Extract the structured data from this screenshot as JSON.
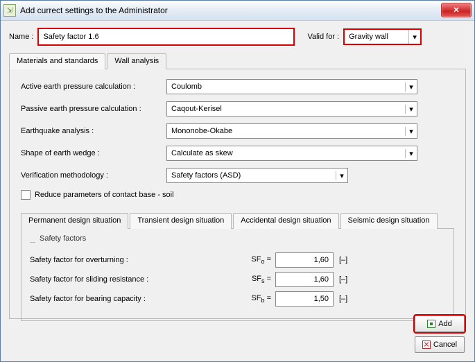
{
  "window": {
    "title": "Add currect settings to the Administrator"
  },
  "header": {
    "name_label": "Name :",
    "name_value": "Safety factor 1.6",
    "validfor_label": "Valid for :",
    "validfor_value": "Gravity wall"
  },
  "tabs": {
    "t0": "Materials and standards",
    "t1": "Wall analysis"
  },
  "form": {
    "active_label": "Active earth pressure calculation :",
    "active_value": "Coulomb",
    "passive_label": "Passive earth pressure calculation :",
    "passive_value": "Caqout-Kerisel",
    "eq_label": "Earthquake analysis :",
    "eq_value": "Mononobe-Okabe",
    "shape_label": "Shape of earth wedge :",
    "shape_value": "Calculate as skew",
    "verif_label": "Verification methodology :",
    "verif_value": "Safety factors (ASD)",
    "reduce_label": "Reduce parameters of contact base - soil"
  },
  "subtabs": {
    "s0": "Permanent design situation",
    "s1": "Transient design situation",
    "s2": "Accidental design situation",
    "s3": "Seismic design situation"
  },
  "sf": {
    "group": "Safety factors",
    "ovr_label": "Safety factor for overturning :",
    "ovr_sym": "SF",
    "ovr_sub": "o",
    "ovr_eq": "=",
    "ovr_val": "1,60",
    "ovr_unit": "[–]",
    "sld_label": "Safety factor for sliding resistance :",
    "sld_sym": "SF",
    "sld_sub": "s",
    "sld_eq": "=",
    "sld_val": "1,60",
    "sld_unit": "[–]",
    "brg_label": "Safety factor for bearing capacity :",
    "brg_sym": "SF",
    "brg_sub": "b",
    "brg_eq": "=",
    "brg_val": "1,50",
    "brg_unit": "[–]"
  },
  "buttons": {
    "add": "Add",
    "cancel": "Cancel"
  }
}
